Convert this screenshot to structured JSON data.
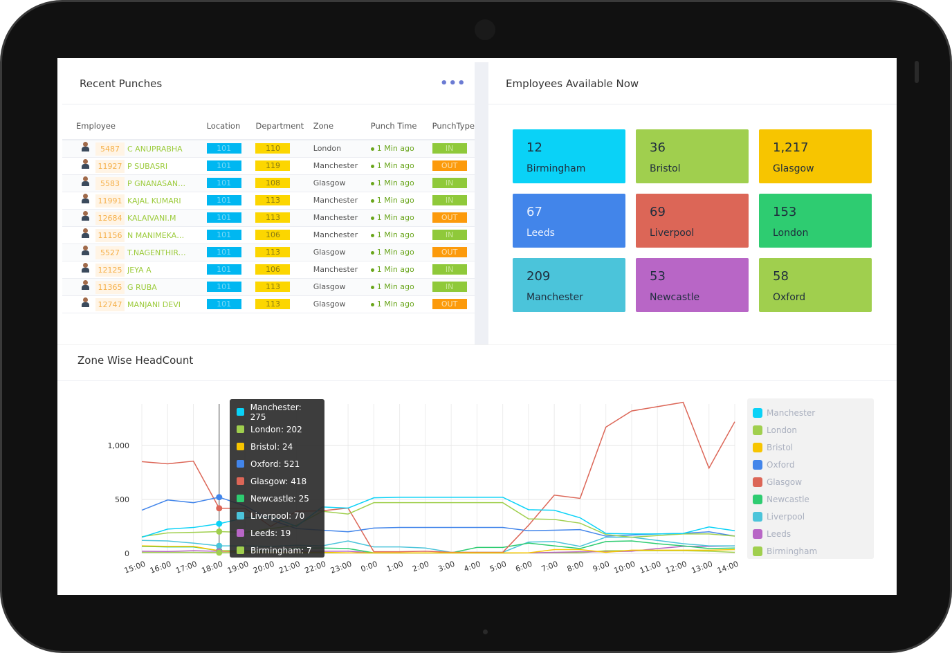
{
  "recent_punches": {
    "title": "Recent Punches",
    "columns": [
      "Employee",
      "Location",
      "Department",
      "Zone",
      "Punch Time",
      "PunchType"
    ],
    "rows": [
      {
        "id": "5487",
        "name": "C ANUPRABHA",
        "location": "101",
        "department": "110",
        "zone": "London",
        "time": "1 Min ago",
        "type": "IN"
      },
      {
        "id": "11927",
        "name": "P SUBASRI",
        "location": "101",
        "department": "119",
        "zone": "Manchester",
        "time": "1 Min ago",
        "type": "OUT"
      },
      {
        "id": "5583",
        "name": "P GNANASANK...",
        "location": "101",
        "department": "108",
        "zone": "Glasgow",
        "time": "1 Min ago",
        "type": "IN"
      },
      {
        "id": "11991",
        "name": "KAJAL KUMARI",
        "location": "101",
        "department": "113",
        "zone": "Manchester",
        "time": "1 Min ago",
        "type": "IN"
      },
      {
        "id": "12684",
        "name": "KALAIVANI.M",
        "location": "101",
        "department": "113",
        "zone": "Manchester",
        "time": "1 Min ago",
        "type": "OUT"
      },
      {
        "id": "11156",
        "name": "N MANIMEKALAI",
        "location": "101",
        "department": "106",
        "zone": "Manchester",
        "time": "1 Min ago",
        "type": "IN"
      },
      {
        "id": "5527",
        "name": "T.NAGENTHIRAN",
        "location": "101",
        "department": "113",
        "zone": "Glasgow",
        "time": "1 Min ago",
        "type": "OUT"
      },
      {
        "id": "12125",
        "name": "JEYA A",
        "location": "101",
        "department": "106",
        "zone": "Manchester",
        "time": "1 Min ago",
        "type": "IN"
      },
      {
        "id": "11365",
        "name": "G RUBA",
        "location": "101",
        "department": "113",
        "zone": "Glasgow",
        "time": "1 Min ago",
        "type": "IN"
      },
      {
        "id": "12747",
        "name": "MANJANI DEVI",
        "location": "101",
        "department": "113",
        "zone": "Glasgow",
        "time": "1 Min ago",
        "type": "OUT"
      }
    ]
  },
  "employees_available": {
    "title": "Employees Available Now",
    "tiles": [
      {
        "count": "12",
        "zone": "Birmingham",
        "color": "#0ad2f7"
      },
      {
        "count": "36",
        "zone": "Bristol",
        "color": "#a0cf4e"
      },
      {
        "count": "1,217",
        "zone": "Glasgow",
        "color": "#f7c500"
      },
      {
        "count": "67",
        "zone": "Leeds",
        "color": "#4285ea"
      },
      {
        "count": "69",
        "zone": "Liverpool",
        "color": "#dc6657"
      },
      {
        "count": "153",
        "zone": "London",
        "color": "#2ecc71"
      },
      {
        "count": "209",
        "zone": "Manchester",
        "color": "#4bc4da"
      },
      {
        "count": "53",
        "zone": "Newcastle",
        "color": "#b866c6"
      },
      {
        "count": "58",
        "zone": "Oxford",
        "color": "#a0cf4e"
      }
    ]
  },
  "chart_data": {
    "type": "line",
    "title": "Zone Wise HeadCount",
    "categories": [
      "15:00",
      "16:00",
      "17:00",
      "18:00",
      "19:00",
      "20:00",
      "21:00",
      "22:00",
      "23:00",
      "0:00",
      "1:00",
      "2:00",
      "3:00",
      "4:00",
      "5:00",
      "6:00",
      "7:00",
      "8:00",
      "9:00",
      "10:00",
      "11:00",
      "12:00",
      "13:00",
      "14:00"
    ],
    "yticks": [
      "0",
      "500",
      "1,000"
    ],
    "ylim": [
      0,
      1400
    ],
    "grid": true,
    "legend_placement": "right",
    "series": [
      {
        "name": "Manchester",
        "color": "#0ad2f7",
        "values": [
          150,
          225,
          240,
          275,
          330,
          340,
          250,
          430,
          420,
          515,
          520,
          520,
          520,
          520,
          520,
          405,
          400,
          330,
          185,
          180,
          180,
          185,
          245,
          210
        ]
      },
      {
        "name": "London",
        "color": "#a0cf4e",
        "values": [
          155,
          190,
          195,
          202,
          195,
          230,
          260,
          390,
          365,
          470,
          470,
          470,
          470,
          470,
          470,
          320,
          315,
          280,
          175,
          150,
          165,
          180,
          180,
          160
        ]
      },
      {
        "name": "Bristol",
        "color": "#f7c500",
        "values": [
          70,
          65,
          65,
          24,
          15,
          10,
          10,
          10,
          5,
          5,
          5,
          5,
          5,
          5,
          5,
          5,
          35,
          35,
          10,
          30,
          30,
          30,
          30,
          35
        ]
      },
      {
        "name": "Oxford",
        "color": "#4285ea",
        "values": [
          400,
          495,
          470,
          521,
          440,
          310,
          230,
          215,
          200,
          235,
          240,
          240,
          240,
          240,
          240,
          210,
          215,
          220,
          160,
          170,
          180,
          185,
          200,
          160
        ]
      },
      {
        "name": "Glasgow",
        "color": "#dc6657",
        "values": [
          850,
          830,
          855,
          418,
          418,
          250,
          390,
          395,
          420,
          15,
          15,
          20,
          10,
          10,
          10,
          260,
          540,
          510,
          1170,
          1320,
          1360,
          1400,
          790,
          1220
        ]
      },
      {
        "name": "Newcastle",
        "color": "#2ecc71",
        "values": [
          65,
          60,
          60,
          25,
          25,
          20,
          50,
          50,
          45,
          5,
          5,
          5,
          5,
          55,
          55,
          95,
          70,
          45,
          110,
          115,
          90,
          70,
          45,
          50
        ]
      },
      {
        "name": "Liverpool",
        "color": "#4bc4da",
        "values": [
          120,
          115,
          95,
          70,
          70,
          65,
          75,
          70,
          115,
          60,
          60,
          50,
          10,
          10,
          10,
          105,
          110,
          65,
          150,
          150,
          120,
          90,
          70,
          70
        ]
      },
      {
        "name": "Leeds",
        "color": "#b866c6",
        "values": [
          20,
          18,
          25,
          19,
          15,
          15,
          20,
          20,
          20,
          5,
          5,
          5,
          5,
          5,
          5,
          5,
          10,
          15,
          15,
          20,
          45,
          65,
          65,
          70
        ]
      },
      {
        "name": "Birmingham",
        "color": "#a0cf4e",
        "values": [
          10,
          10,
          10,
          7,
          7,
          5,
          5,
          5,
          5,
          3,
          3,
          3,
          3,
          3,
          3,
          5,
          5,
          5,
          25,
          25,
          25,
          25,
          20,
          10
        ]
      }
    ],
    "tooltip": {
      "category": "18:00",
      "rows": [
        "Manchester: 275",
        "London: 202",
        "Bristol: 24",
        "Oxford: 521",
        "Glasgow: 418",
        "Newcastle: 25",
        "Liverpool: 70",
        "Leeds: 19",
        "Birmingham: 7"
      ]
    }
  }
}
